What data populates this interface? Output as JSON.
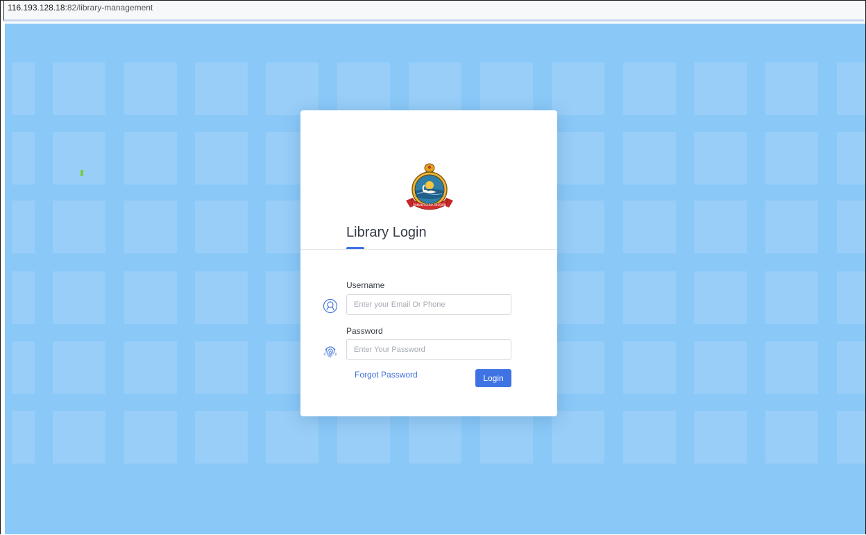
{
  "browser": {
    "url_host": "116.193.128.18",
    "url_rest": ":82/library-management"
  },
  "login": {
    "title": "Library Login",
    "username_label": "Username",
    "username_placeholder": "Enter your Email Or Phone",
    "username_value": "",
    "password_label": "Password",
    "password_placeholder": "Enter Your Password",
    "password_value": "",
    "forgot_link": "Forgot Password",
    "login_button": "Login"
  },
  "emblem": {
    "banner_text": "RAMAKRISHNA MISSION"
  },
  "icons": {
    "username_icon": "user-circle-icon",
    "password_icon": "fingerprint-icon"
  },
  "colors": {
    "background": "#8ac8f8",
    "accent": "#3f73e4",
    "link": "#3f6fd6",
    "card": "#ffffff"
  }
}
